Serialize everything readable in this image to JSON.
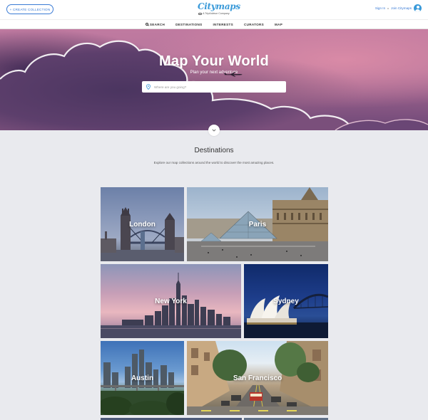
{
  "header": {
    "create_button": "+ CREATE COLLECTION",
    "logo": "Citymaps",
    "logo_sub": "A TripAdvisor Company",
    "sign_in": "Sign In",
    "join": "Join Citymaps"
  },
  "nav": {
    "items": [
      {
        "label": "SEARCH",
        "icon": "search-icon"
      },
      {
        "label": "DESTINATIONS"
      },
      {
        "label": "INTERESTS"
      },
      {
        "label": "CURATORS"
      },
      {
        "label": "MAP"
      }
    ]
  },
  "hero": {
    "title": "Map Your World",
    "subtitle": "Plan your next adventure",
    "search_placeholder": "Where are you going?"
  },
  "destinations": {
    "title": "Destinations",
    "description": "Explore our map collections around the world to discover the most amazing places.",
    "tiles": [
      {
        "label": "London"
      },
      {
        "label": "Paris"
      },
      {
        "label": "New York"
      },
      {
        "label": "Sydney"
      },
      {
        "label": "Austin"
      },
      {
        "label": "San Francisco"
      }
    ]
  },
  "colors": {
    "accent": "#3a7bd5",
    "logo": "#3a9ad9",
    "background": "#e9eaee"
  }
}
